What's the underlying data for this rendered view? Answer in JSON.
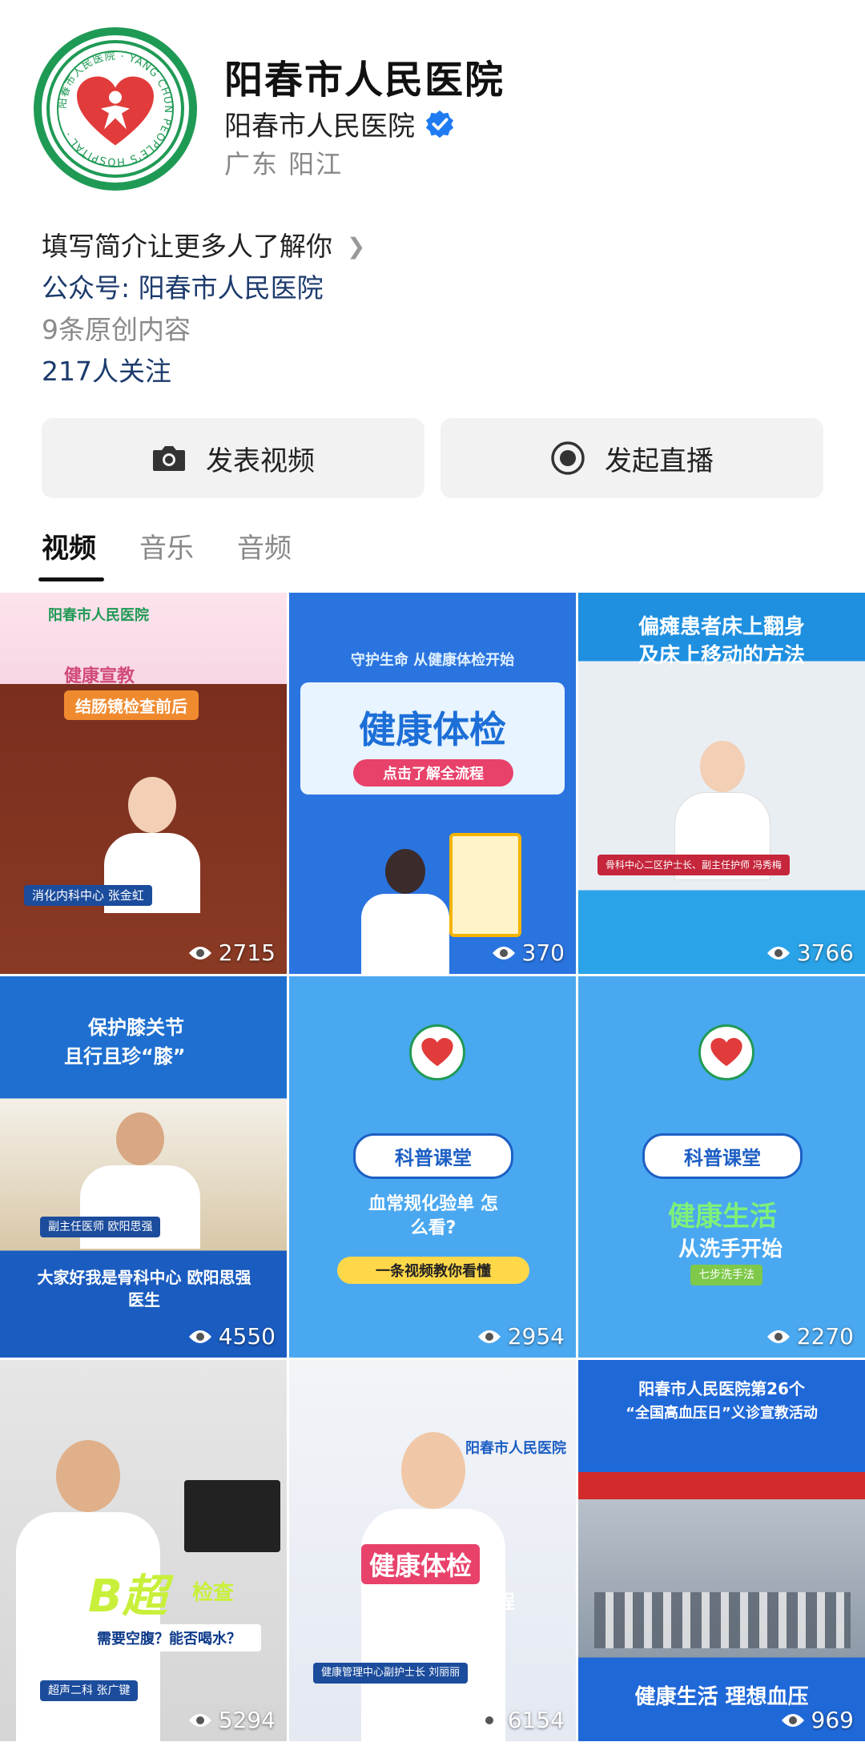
{
  "profile": {
    "name": "阳春市人民医院",
    "verified_name": "阳春市人民医院",
    "location": "广东 阳江",
    "logo_ring_text": "阳春市人民医院 YANG CHUN PEOPLE'S HOSPITAL"
  },
  "info": {
    "intro": "填写简介让更多人了解你",
    "official_account": "公众号: 阳春市人民医院",
    "original_count": "9条原创内容",
    "followers": "217人关注"
  },
  "actions": {
    "post_video": "发表视频",
    "start_live": "发起直播"
  },
  "tabs": [
    {
      "label": "视频",
      "active": true
    },
    {
      "label": "音乐",
      "active": false
    },
    {
      "label": "音频",
      "active": false
    }
  ],
  "videos": [
    {
      "views": "2715",
      "title": "健康宣教",
      "subtitle": "结肠镜检查前后",
      "header": "阳春市人民医院",
      "caption": "消化内科中心 张金虹"
    },
    {
      "views": "370",
      "title": "健康体检",
      "subtitle": "点击了解全流程",
      "header": "守护生命 从健康体检开始"
    },
    {
      "views": "3766",
      "title": "偏瘫患者床上翻身",
      "subtitle": "及床上移动的方法",
      "caption": "骨科中心二区护士长、副主任护师 冯秀梅"
    },
    {
      "views": "4550",
      "title": "保护膝关节",
      "subtitle": "且行且珍“膝”",
      "caption": "大家好我是骨科中心 欧阳思强医生",
      "tag": "副主任医师 欧阳思强"
    },
    {
      "views": "2954",
      "title": "科普课堂",
      "subtitle": "血常规化验单 怎么看?",
      "caption": "一条视频教你看懂"
    },
    {
      "views": "2270",
      "title": "科普课堂",
      "subtitle": "健康生活",
      "caption": "从洗手开始",
      "tag": "七步洗手法"
    },
    {
      "views": "5294",
      "title": "B超",
      "subtitle": "检查",
      "caption": "需要空腹？能否喝水？",
      "tag": "超声二科 张广键"
    },
    {
      "views": "6154",
      "title": "健康体检",
      "subtitle": "全流程",
      "caption": "健康管理中心副护士长 刘丽丽",
      "header": "阳春市人民医院"
    },
    {
      "views": "969",
      "title": "阳春市人民医院第26个",
      "subtitle": "“全国高血压日”义诊宣教活动",
      "caption": "健康生活 理想血压"
    }
  ],
  "colors": {
    "brand_green": "#1f9a55",
    "brand_red": "#e23b3b",
    "link_navy": "#1d3b6d",
    "verified_blue": "#1f7bf2",
    "button_bg": "#f2f2f2"
  }
}
